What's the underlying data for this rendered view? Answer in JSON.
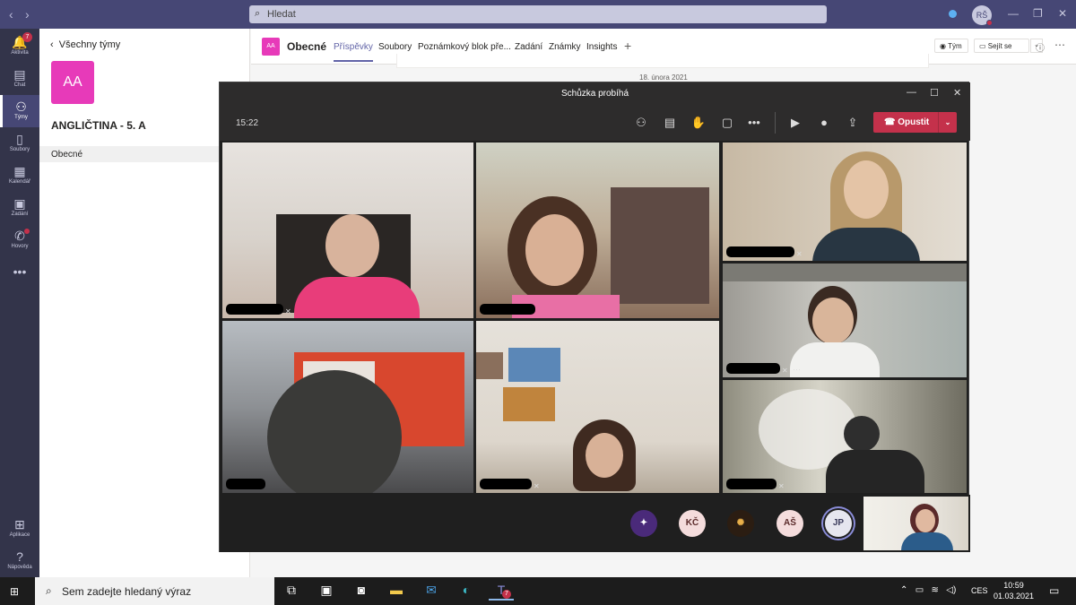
{
  "titlebar": {
    "search_placeholder": "Hledat",
    "user_initials": "RŠ"
  },
  "rail": [
    {
      "label": "Aktivita",
      "badge": "7"
    },
    {
      "label": "Chat"
    },
    {
      "label": "Týmy"
    },
    {
      "label": "Soubory"
    },
    {
      "label": "Kalendář"
    },
    {
      "label": "Zadání"
    },
    {
      "label": "Hovory"
    },
    {
      "label": "Aplikace"
    },
    {
      "label": "Nápověda"
    }
  ],
  "teams": {
    "back_label": "Všechny týmy",
    "team_initials": "AA",
    "team_name": "ANGLIČTINA - 5. A",
    "channel": "Obecné"
  },
  "channel_header": {
    "tile_initials": "AA",
    "name": "Obecné",
    "tabs": [
      "Příspěvky",
      "Soubory",
      "Poznámkový blok pře...",
      "Zadání",
      "Známky",
      "Insights"
    ],
    "team_btn": "Tým",
    "meet_btn": "Sejít se"
  },
  "feed": {
    "date": "18. února 2021"
  },
  "meeting": {
    "title": "Schůzka probíhá",
    "timer": "15:22",
    "leave_label": "Opustit",
    "participants": [
      "KČ",
      "AŠ",
      "JP"
    ]
  },
  "taskbar": {
    "search_placeholder": "Sem zadejte hledaný výraz",
    "teams_badge": "7",
    "lang": "CES",
    "time": "10:59",
    "date": "01.03.2021"
  },
  "colors": {
    "teams_purple": "#464775",
    "rail_dark": "#33344a",
    "brand": "#6264a7",
    "leave_red": "#c4314b",
    "team_tile": "#e73ab9"
  }
}
